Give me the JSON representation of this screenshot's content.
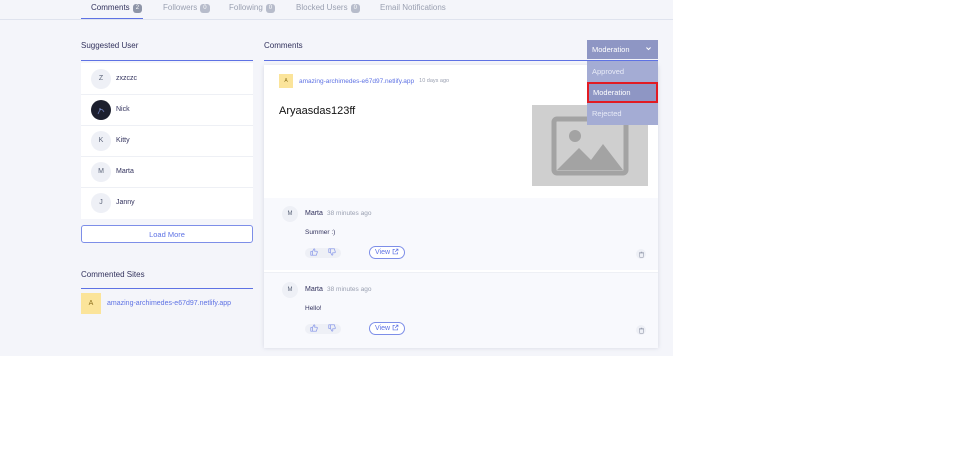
{
  "tabs": [
    {
      "label": "Comments",
      "count": "2"
    },
    {
      "label": "Followers",
      "count": "0"
    },
    {
      "label": "Following",
      "count": "0"
    },
    {
      "label": "Blocked Users",
      "count": "0"
    },
    {
      "label": "Email Notifications",
      "count": ""
    }
  ],
  "suggested": {
    "title": "Suggested User",
    "users": [
      {
        "initial": "Z",
        "name": "zxzczc"
      },
      {
        "initial": "",
        "name": "Nick"
      },
      {
        "initial": "K",
        "name": "Kitty"
      },
      {
        "initial": "M",
        "name": "Marta"
      },
      {
        "initial": "J",
        "name": "Janny"
      }
    ],
    "load_more": "Load More"
  },
  "commented_sites": {
    "title": "Commented Sites",
    "items": [
      {
        "initial": "A",
        "url": "amazing-archimedes-e67d97.netlify.app"
      }
    ]
  },
  "comments": {
    "title": "Comments",
    "post": {
      "favicon": "A",
      "site": "amazing-archimedes-e67d97.netlify.app",
      "time": "10 days ago",
      "title": "Aryaasdas123ff"
    },
    "items": [
      {
        "initial": "M",
        "author": "Marta",
        "time": "38 minutes ago",
        "text": "Summer :)",
        "view": "View"
      },
      {
        "initial": "M",
        "author": "Marta",
        "time": "38 minutes ago",
        "text": "Hello!",
        "view": "View"
      }
    ]
  },
  "dropdown": {
    "selected": "Moderation",
    "options": [
      "Approved",
      "Moderation",
      "Rejected"
    ]
  },
  "colors": {
    "accent": "#5e72e4",
    "dropdown": "#8e96c4",
    "highlight": "#e21b23"
  }
}
